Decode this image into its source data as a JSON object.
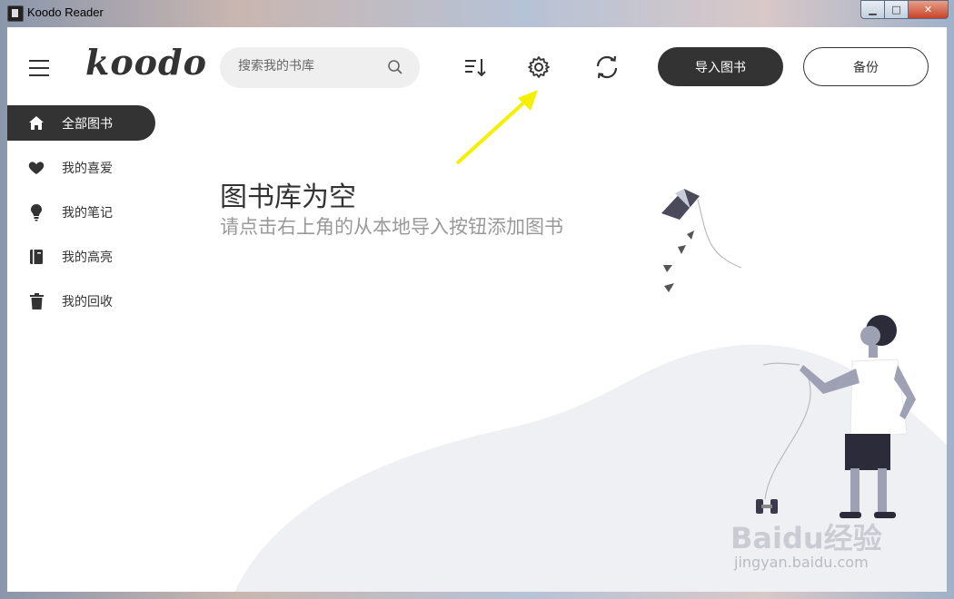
{
  "window": {
    "title": "Koodo Reader",
    "controls": {
      "minimize": "▁",
      "maximize": "□",
      "close": "✕"
    }
  },
  "header": {
    "logo": "koodo",
    "search": {
      "placeholder": "搜索我的书库",
      "value": ""
    },
    "tools": [
      "sort-icon",
      "gear-icon",
      "sync-icon"
    ],
    "import_label": "导入图书",
    "backup_label": "备份"
  },
  "sidebar": {
    "items": [
      {
        "label": "全部图书",
        "icon": "home-icon",
        "active": true
      },
      {
        "label": "我的喜爱",
        "icon": "heart-icon",
        "active": false
      },
      {
        "label": "我的笔记",
        "icon": "bulb-icon",
        "active": false
      },
      {
        "label": "我的高亮",
        "icon": "book-icon",
        "active": false
      },
      {
        "label": "我的回收",
        "icon": "trash-icon",
        "active": false
      }
    ]
  },
  "main": {
    "empty_title": "图书库为空",
    "empty_desc": "请点击右上角的从本地导入按钮添加图书"
  },
  "overlay": {
    "watermark": "Baidu经验",
    "watermark_url": "jingyan.baidu.com",
    "arrow_color": "#f5f000"
  },
  "colors": {
    "accent": "#333333",
    "muted": "#999999"
  }
}
